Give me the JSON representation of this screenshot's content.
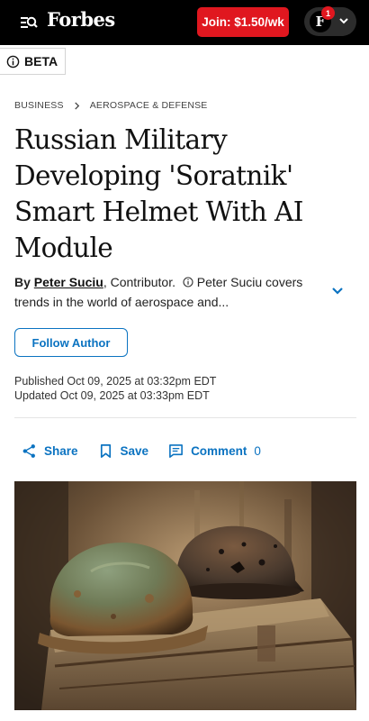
{
  "header": {
    "logo": "Forbes",
    "join_label": "Join: $1.50/wk",
    "account_initial": "F",
    "notification_count": "1"
  },
  "beta_label": "BETA",
  "breadcrumb": {
    "section": "BUSINESS",
    "subsection": "AEROSPACE & DEFENSE"
  },
  "article": {
    "headline": "Russian Military Developing 'Soratnik' Smart Helmet With AI Module",
    "by_prefix": "By",
    "author": "Peter Suciu",
    "role": ", Contributor.",
    "bio": "Peter Suciu covers trends in the world of aerospace and...",
    "follow_label": "Follow Author",
    "published": "Published Oct 09, 2025 at 03:32pm EDT",
    "updated": "Updated Oct 09, 2025 at 03:33pm EDT"
  },
  "actions": {
    "share_label": "Share",
    "save_label": "Save",
    "comment_label": "Comment",
    "comment_count": "0"
  },
  "colors": {
    "accent_blue": "#0b73c1",
    "join_red": "#e0171f",
    "topbar_black": "#000000"
  }
}
